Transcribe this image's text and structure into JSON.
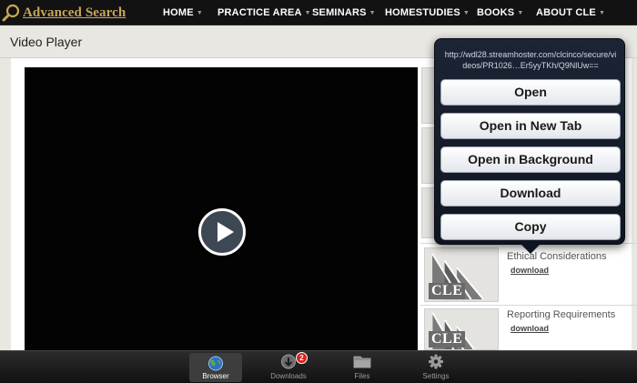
{
  "header": {
    "brand": "Advanced Search",
    "nav": [
      "HOME",
      "PRACTICE AREA",
      "SEMINARS",
      "HOMESTUDIES",
      "BOOKS",
      "ABOUT CLE"
    ]
  },
  "page": {
    "title": "Video Player"
  },
  "popover": {
    "url": "http://wdl28.streamhoster.com/clcinco/secure/videos/PR1026…Er5yyTKh/Q9NlUw==",
    "actions": [
      "Open",
      "Open in New Tab",
      "Open in Background",
      "Download",
      "Copy"
    ]
  },
  "playlist": {
    "thumb_label": "CLE",
    "items": [
      {
        "title": "Ethical Considerations",
        "link": "download"
      },
      {
        "title": "Reporting Requirements",
        "link": "download"
      }
    ]
  },
  "tabbar": {
    "tabs": [
      {
        "label": "Browser",
        "icon": "globe-icon",
        "active": true
      },
      {
        "label": "Downloads",
        "icon": "download-icon",
        "badge": "2"
      },
      {
        "label": "Files",
        "icon": "folder-icon"
      },
      {
        "label": "Settings",
        "icon": "gear-icon"
      }
    ]
  },
  "colors": {
    "nav_bg": "#121212",
    "brand": "#c9a45a",
    "popover_bg": "#131b28",
    "badge": "#d8231c"
  }
}
